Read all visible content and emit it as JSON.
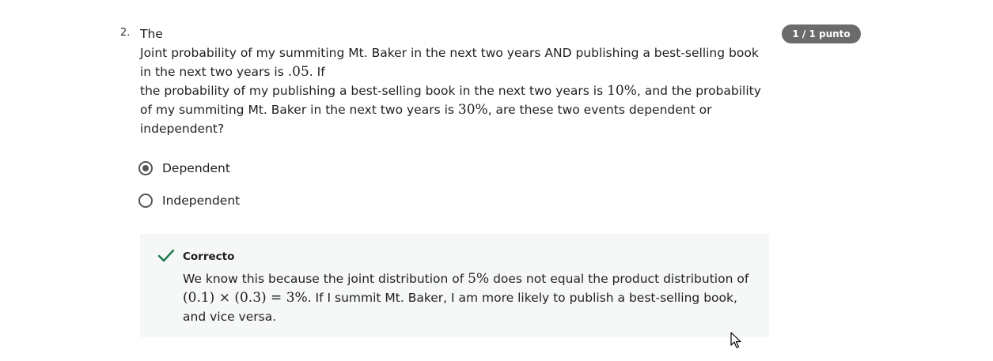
{
  "question": {
    "number": "2.",
    "line_the": "The",
    "sentence_a": "Joint probability of my summiting Mt. Baker in the next two years AND publishing a best-selling book in the next two years is ",
    "joint_value": ".05",
    "sentence_b": ". If",
    "sentence_c": "the probability of my publishing a best-selling book in the next two years is ",
    "book_prob": "10%",
    "sentence_d": ", and the probability of my summiting Mt. Baker in the next two years is ",
    "baker_prob": "30%",
    "sentence_e": ", are these two events dependent or independent?"
  },
  "score_badge": "1 / 1 punto",
  "options": [
    {
      "label": "Dependent",
      "selected": true
    },
    {
      "label": "Independent",
      "selected": false
    }
  ],
  "feedback": {
    "status": "Correcto",
    "text_a": "We know this because the joint distribution of ",
    "joint_pct": "5%",
    "text_b": " does not equal the product distribution of ",
    "product_expr": "(0.1) × (0.3) = 3%",
    "text_c": ". If I summit Mt. Baker, I am more likely to publish a best-selling book, and vice versa."
  },
  "colors": {
    "badge_bg": "#6b6b6b",
    "feedback_bg": "#f5f8f7",
    "check_green": "#1d7a4a"
  },
  "icons": {
    "check": "checkmark-icon",
    "cursor": "mouse-pointer-icon"
  }
}
